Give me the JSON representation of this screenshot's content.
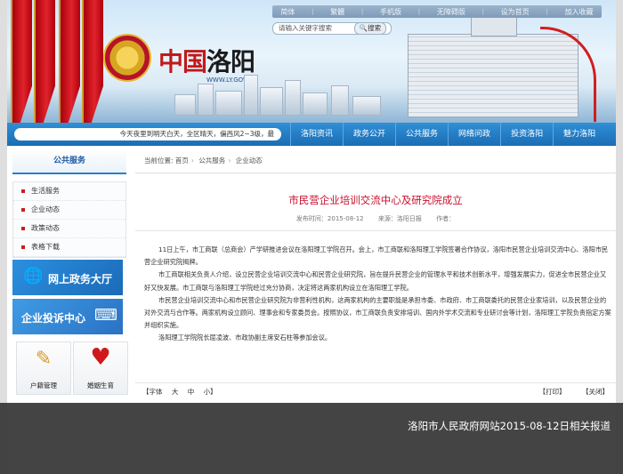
{
  "top_links": [
    "简体",
    "繁體",
    "手机版",
    "无障碍版",
    "设为首页",
    "加入收藏"
  ],
  "search": {
    "placeholder": "请输入关键字搜索",
    "button": "搜索"
  },
  "brand": {
    "name_red": "中国",
    "name_black": "洛阳",
    "url": "WWW.LY.GOV.CN"
  },
  "weather_text": "今天夜里到明天白天，全区晴天，偏西风2~3级，最",
  "main_menu": [
    "洛阳资讯",
    "政务公开",
    "公共服务",
    "网络问政",
    "投资洛阳",
    "魅力洛阳"
  ],
  "sidebar": {
    "title": "公共服务",
    "items": [
      "生活服务",
      "企业动态",
      "政策动态",
      "表格下载"
    ],
    "promo1": "网上政务大厅",
    "promo2": "企业投诉中心",
    "tiles": [
      "户籍管理",
      "婚姻生育"
    ]
  },
  "breadcrumb": {
    "prefix": "当前位置:",
    "home": "首页",
    "level1": "公共服务",
    "level2": "企业动态"
  },
  "article": {
    "title": "市民营企业培训交流中心及研究院成立",
    "publish_time": "发布时间：2015-08-12",
    "source": "来源：洛阳日报",
    "author": "作者：",
    "paragraphs": [
      "11日上午，市工商联（总商会）产学研推进会议在洛阳理工学院召开。会上，市工商联和洛阳理工学院签署合作协议，洛阳市民营企业培训交流中心、洛阳市民营企业研究院揭牌。",
      "市工商联相关负责人介绍，设立民营企业培训交流中心和民营企业研究院，旨在提升民营企业的管理水平和技术创新水平，增强发展实力，促进全市民营企业又好又快发展。市工商联与洛阳理工学院经过充分协商，决定将这两家机构设立在洛阳理工学院。",
      "市民营企业培训交流中心和市民营企业研究院为非营利性机构，这两家机构的主要职能是承担市委、市政府、市工商联委托的民营企业家培训，以及民营企业的对外交流与合作等。两家机构设立顾问、理事会和专家委员会。按照协议，市工商联负责安排培训、国内外学术交流和专业研讨会等计划，洛阳理工学院负责指定方案并组织实施。",
      "洛阳理工学院院长屈凌波、市政协副主席安石柱等参加会议。"
    ]
  },
  "font_size": {
    "label": "【字体",
    "big": "大",
    "mid": "中",
    "small": "小】"
  },
  "actions": {
    "print": "【打印】",
    "close": "【关闭】"
  },
  "caption": "洛阳市人民政府网站2015-08-12日相关报道"
}
